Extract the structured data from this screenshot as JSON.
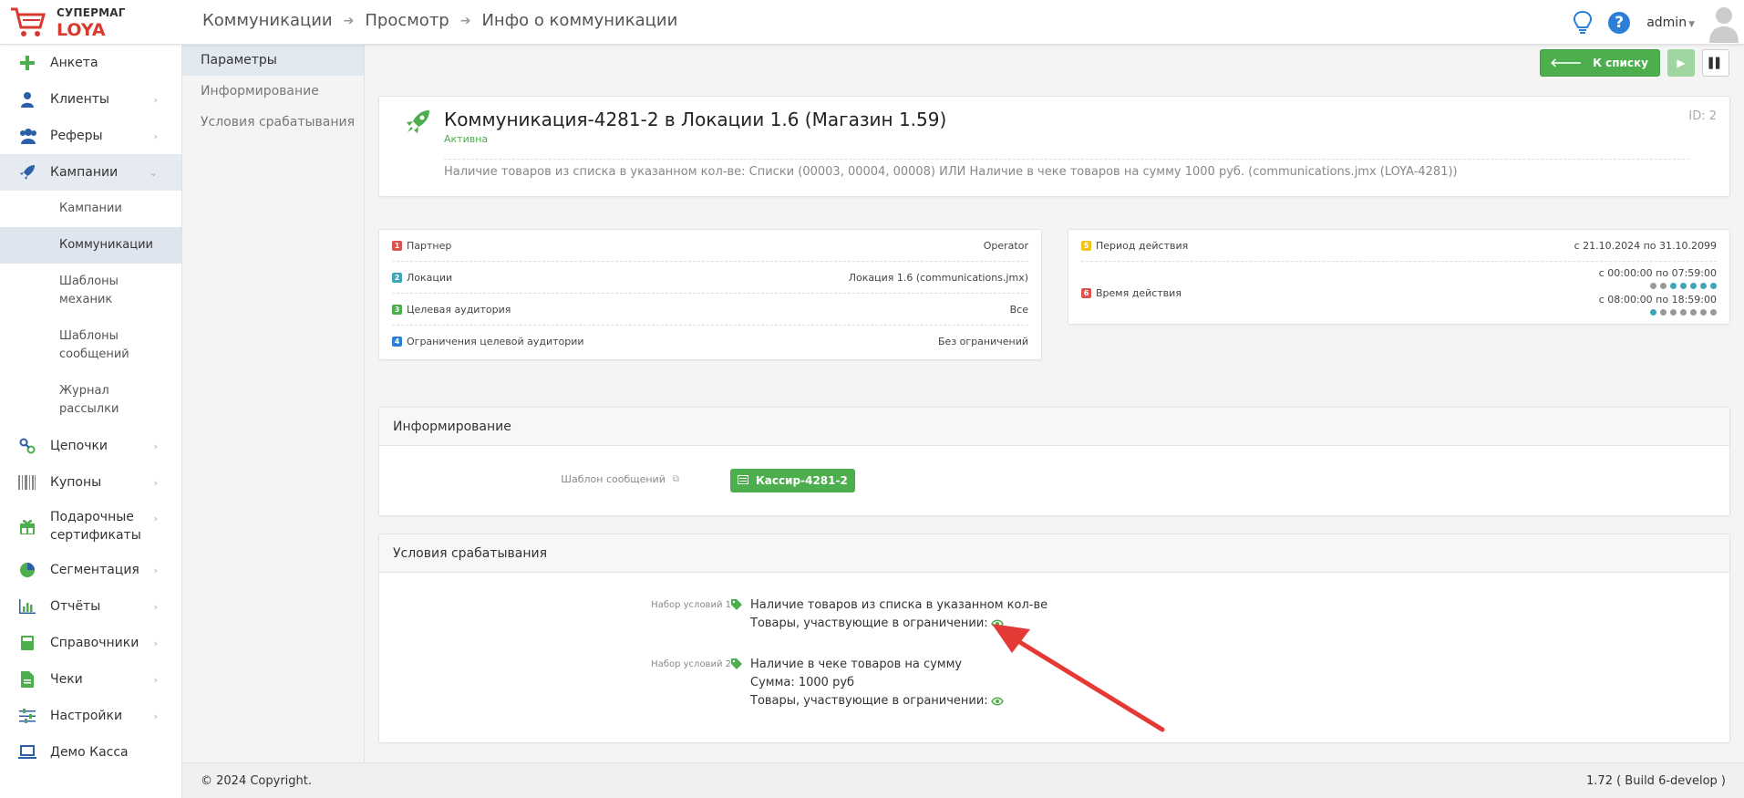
{
  "brand": {
    "line1": "СУПЕРМАГ",
    "line2": "LOYA"
  },
  "breadcrumb": [
    "Коммуникации",
    "Просмотр",
    "Инфо о коммуникации"
  ],
  "user": {
    "name": "admin"
  },
  "sidebar": {
    "items": [
      {
        "label": "Анкета"
      },
      {
        "label": "Клиенты"
      },
      {
        "label": "Реферы"
      },
      {
        "label": "Кампании"
      },
      {
        "label": "Цепочки"
      },
      {
        "label": "Купоны"
      },
      {
        "label": "Подарочные\nсертификаты"
      },
      {
        "label": "Сегментация"
      },
      {
        "label": "Отчёты"
      },
      {
        "label": "Справочники"
      },
      {
        "label": "Чеки"
      },
      {
        "label": "Настройки"
      },
      {
        "label": "Демо Касса"
      }
    ],
    "subitems": [
      {
        "label": "Кампании"
      },
      {
        "label": "Коммуникации"
      },
      {
        "label": "Шаблоны\nмеханик"
      },
      {
        "label": "Шаблоны\nсообщений"
      },
      {
        "label": "Журнал\nрассылки"
      }
    ]
  },
  "subnav": [
    "Параметры",
    "Информирование",
    "Условия срабатывания"
  ],
  "toolbar": {
    "back_label": "К списку"
  },
  "communication": {
    "title": "Коммуникация-4281-2 в Локации 1.6 (Магазин 1.59)",
    "status": "Активна",
    "id": "ID: 2",
    "description": "Наличие товаров из списка в указанном кол-ве: Списки (00003, 00004, 00008) ИЛИ Наличие в чеке товаров на сумму 1000 руб. (communications.jmx (LOYA-4281))"
  },
  "params": [
    {
      "num": "1",
      "color": "#d9534f",
      "label": "Партнер",
      "value": "Operator"
    },
    {
      "num": "2",
      "color": "#3fa6b8",
      "label": "Локации",
      "value": "Локация 1.6 (communications.jmx)"
    },
    {
      "num": "3",
      "color": "#4cae4c",
      "label": "Целевая аудитория",
      "value": "Все"
    },
    {
      "num": "4",
      "color": "#2b7fd6",
      "label": "Ограничения целевой аудитории",
      "value": "Без ограничений"
    }
  ],
  "period": {
    "p5": {
      "num": "5",
      "color": "#f0c419",
      "label": "Период действия",
      "value": "с 21.10.2024 по 31.10.2099"
    },
    "p6": {
      "num": "6",
      "color": "#d9534f",
      "label": "Время действия",
      "t1": "с 00:00:00 по 07:59:00",
      "t2": "с 08:00:00 по 18:59:00"
    },
    "dots1": [
      false,
      false,
      true,
      true,
      true,
      true,
      true
    ],
    "dots2": [
      true,
      false,
      false,
      false,
      false,
      false,
      false
    ]
  },
  "inform": {
    "title": "Информирование",
    "template_label": "Шаблон сообщений",
    "template_value": "Кассир-4281-2"
  },
  "conditions": {
    "title": "Условия срабатывания",
    "set1_label": "Набор условий 1",
    "set1_line1": "Наличие товаров из списка в указанном кол-ве",
    "set1_line2": "Товары, участвующие в ограничении:",
    "set2_label": "Набор условий 2",
    "set2_line1": "Наличие в чеке товаров на сумму",
    "set2_line2": "Сумма: 1000 руб",
    "set2_line3": "Товары, участвующие в ограничении:"
  },
  "footer": {
    "copyright": "© 2024 Copyright.",
    "version": "1.72 ( Build 6-develop )"
  },
  "colors": {
    "accent_green": "#4cae4c",
    "brand_red": "#d93a2f",
    "arrow_red": "#e53935"
  }
}
